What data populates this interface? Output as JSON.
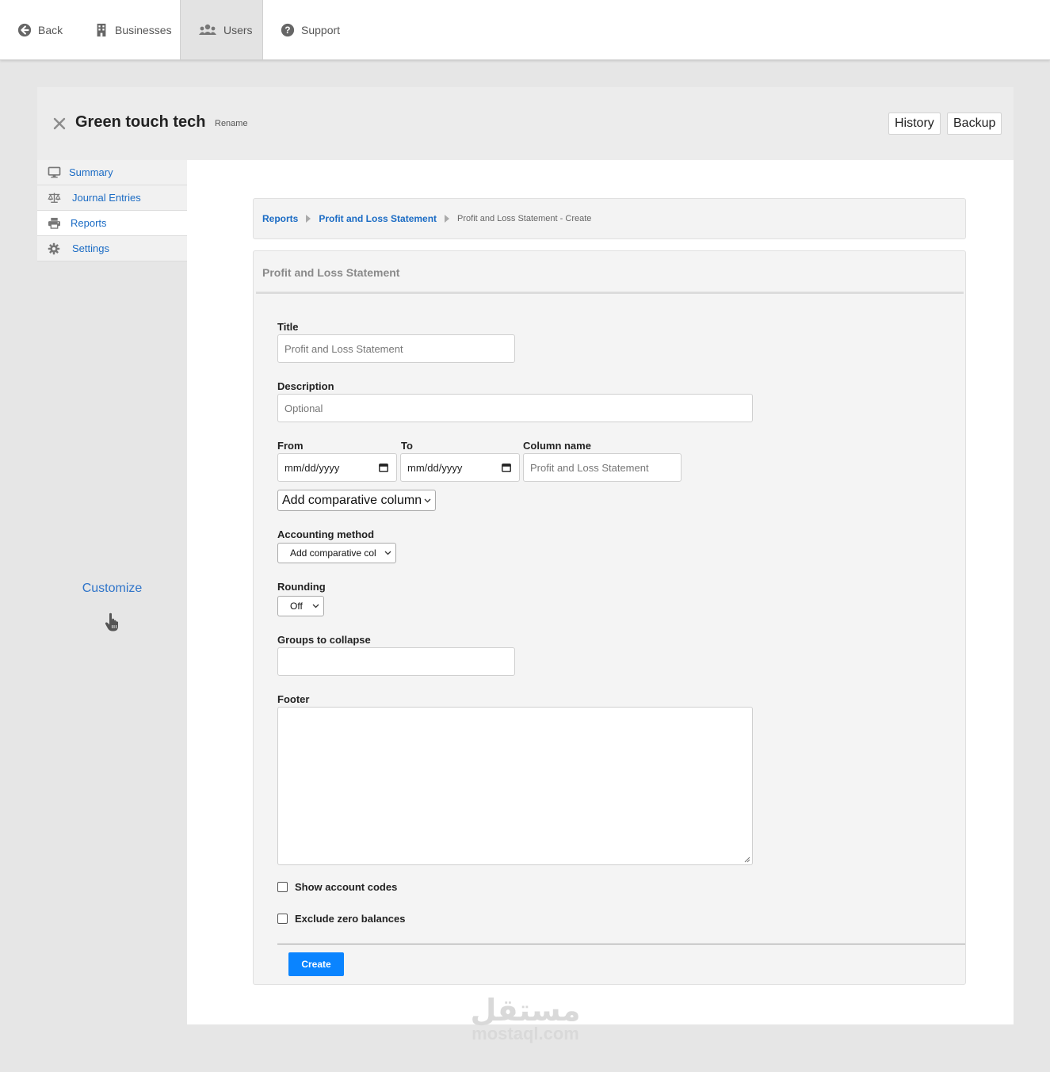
{
  "nav": {
    "back": "Back",
    "businesses": "Businesses",
    "users": "Users",
    "support": "Support"
  },
  "business": {
    "name": "Green touch tech",
    "rename": "Rename",
    "history": "History",
    "backup": "Backup"
  },
  "sidebar": {
    "items": [
      {
        "label": "Summary",
        "icon": "monitor-icon"
      },
      {
        "label": "Journal Entries",
        "icon": "scale-icon"
      },
      {
        "label": "Reports",
        "icon": "printer-icon"
      },
      {
        "label": "Settings",
        "icon": "gear-icon"
      }
    ],
    "customize": "Customize"
  },
  "breadcrumb": {
    "reports": "Reports",
    "pl": "Profit and Loss Statement",
    "current": "Profit and Loss Statement - Create"
  },
  "form": {
    "panel_title": "Profit and Loss Statement",
    "title_label": "Title",
    "title_value": "Profit and Loss Statement",
    "description_label": "Description",
    "description_placeholder": "Optional",
    "from_label": "From",
    "from_value": "mm/dd/yyyy",
    "to_label": "To",
    "to_value": "mm/dd/yyyy",
    "column_name_label": "Column name",
    "column_name_placeholder": "Profit and Loss Statement",
    "comparative_select": "Add comparative column",
    "accounting_method_label": "Accounting method",
    "accounting_method_value": "Add comparative col",
    "rounding_label": "Rounding",
    "rounding_value": "Off",
    "groups_label": "Groups to collapse",
    "footer_label": "Footer",
    "show_codes_label": "Show account codes",
    "exclude_zero_label": "Exclude zero balances",
    "create_button": "Create"
  },
  "watermark": {
    "arabic": "مستقل",
    "latin": "mostaql.com"
  },
  "colors": {
    "link": "#1a6bc4",
    "primary_button": "#0a84ff",
    "page_bg": "#e6e6e6"
  }
}
